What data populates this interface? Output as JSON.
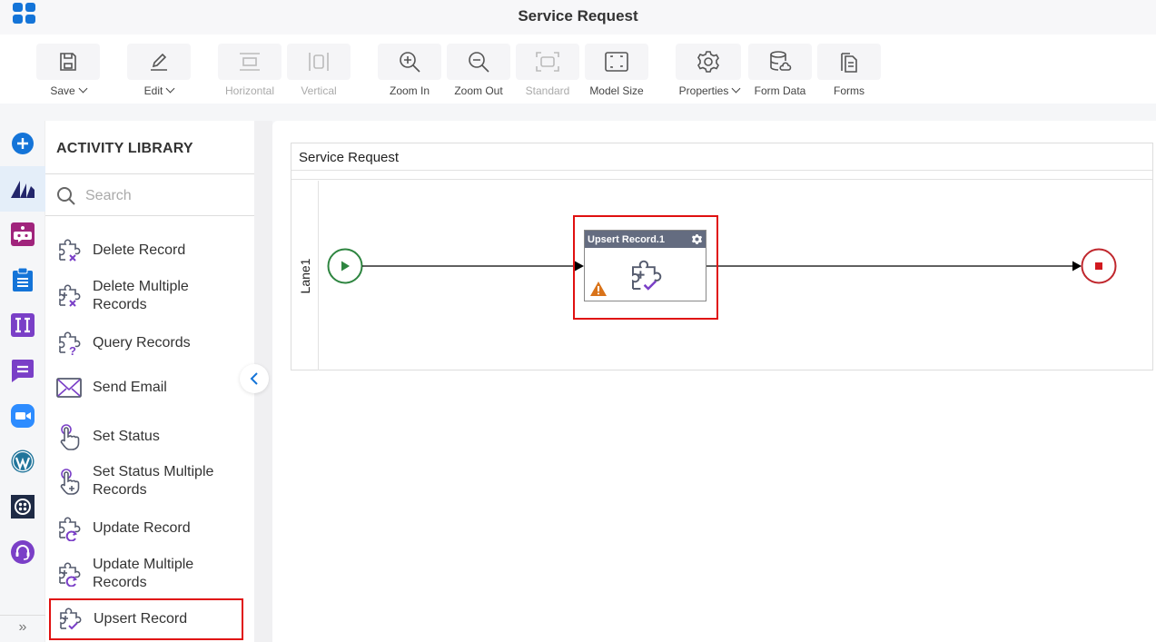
{
  "app": {
    "title": "Service Request",
    "brand_color": "#1474d8"
  },
  "toolbar": {
    "buttons": [
      {
        "label": "Save",
        "icon": "save-icon",
        "dropdown": true,
        "enabled": true
      },
      {
        "label": "Edit",
        "icon": "edit-icon",
        "dropdown": true,
        "enabled": true
      },
      {
        "label": "Horizontal",
        "icon": "horizontal-icon",
        "dropdown": false,
        "enabled": false
      },
      {
        "label": "Vertical",
        "icon": "vertical-icon",
        "dropdown": false,
        "enabled": false
      },
      {
        "label": "Zoom In",
        "icon": "zoom-in-icon",
        "dropdown": false,
        "enabled": true
      },
      {
        "label": "Zoom Out",
        "icon": "zoom-out-icon",
        "dropdown": false,
        "enabled": true
      },
      {
        "label": "Standard",
        "icon": "standard-icon",
        "dropdown": false,
        "enabled": false
      },
      {
        "label": "Model Size",
        "icon": "model-size-icon",
        "dropdown": false,
        "enabled": true
      },
      {
        "label": "Properties",
        "icon": "gear-icon",
        "dropdown": true,
        "enabled": true
      },
      {
        "label": "Form Data",
        "icon": "database-icon",
        "dropdown": false,
        "enabled": true
      },
      {
        "label": "Forms",
        "icon": "forms-icon",
        "dropdown": false,
        "enabled": true
      }
    ]
  },
  "leftbar": {
    "items": [
      {
        "name": "add",
        "icon": "plus-circle-icon",
        "color": "#1474d8"
      },
      {
        "name": "dynamics-crm",
        "icon": "dynamics-icon",
        "color": "#23266b",
        "active": true
      },
      {
        "name": "bot",
        "icon": "bot-icon",
        "color": "#a0247c"
      },
      {
        "name": "tasks",
        "icon": "clipboard-icon",
        "color": "#1474d8"
      },
      {
        "name": "integration",
        "icon": "ii-icon",
        "color": "#7a3fc7"
      },
      {
        "name": "chat",
        "icon": "chat-icon",
        "color": "#7a3fc7"
      },
      {
        "name": "zoom",
        "icon": "video-icon",
        "color": "#2d8cff"
      },
      {
        "name": "wordpress",
        "icon": "wordpress-icon",
        "color": "#21759b"
      },
      {
        "name": "twilio",
        "icon": "twilio-icon",
        "color": "#1e2a45"
      },
      {
        "name": "support",
        "icon": "headset-icon",
        "color": "#7a3fc7"
      }
    ],
    "expand_label": "»"
  },
  "library": {
    "title": "ACTIVITY LIBRARY",
    "search_placeholder": "Search",
    "search_value": "",
    "items": [
      {
        "label": "Delete Record",
        "icon": "puzzle-delete-icon"
      },
      {
        "label": "Delete Multiple Records",
        "icon": "puzzle-delete-multiple-icon"
      },
      {
        "label": "Query Records",
        "icon": "puzzle-query-icon"
      },
      {
        "label": "Send Email",
        "icon": "email-icon"
      },
      {
        "label": "Set Status",
        "icon": "hand-pointer-icon"
      },
      {
        "label": "Set Status Multiple Records",
        "icon": "hand-pointer-plus-icon"
      },
      {
        "label": "Update Record",
        "icon": "puzzle-update-icon"
      },
      {
        "label": "Update Multiple Records",
        "icon": "puzzle-update-multiple-icon"
      },
      {
        "label": "Upsert Record",
        "icon": "puzzle-upsert-icon",
        "highlighted": true
      }
    ]
  },
  "canvas": {
    "pool_title": "Service Request",
    "lane_label": "Lane1",
    "task": {
      "title": "Upsert Record.1",
      "icon": "puzzle-upsert-icon",
      "warning": true,
      "highlighted": true
    },
    "start_color": "#2e8540",
    "end_color": "#c0272d",
    "warning_color": "#d9731a",
    "highlight_color": "#e01010"
  }
}
